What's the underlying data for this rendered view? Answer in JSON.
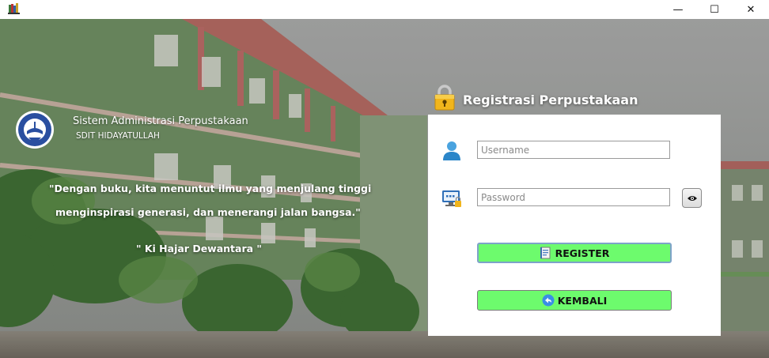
{
  "window": {
    "controls": {
      "minimize": "—",
      "maximize": "☐",
      "close": "✕"
    }
  },
  "branding": {
    "title": "Sistem Administrasi Perpustakaan",
    "subtitle": "SDIT HIDAYATULLAH",
    "logo_icon": "school-seal-logo"
  },
  "quote": {
    "line1": "\"Dengan buku, kita menuntut ilmu yang menjulang tinggi",
    "line2": "menginspirasi generasi, dan menerangi jalan bangsa.\"",
    "author": "\" Ki Hajar Dewantara \""
  },
  "form": {
    "title": "Registrasi Perpustakaan",
    "username_placeholder": "Username",
    "password_placeholder": "Password",
    "register_label": "REGISTER",
    "back_label": "KEMBALI"
  },
  "colors": {
    "button_green": "#6dfb6d",
    "panel": "#ffffff"
  }
}
